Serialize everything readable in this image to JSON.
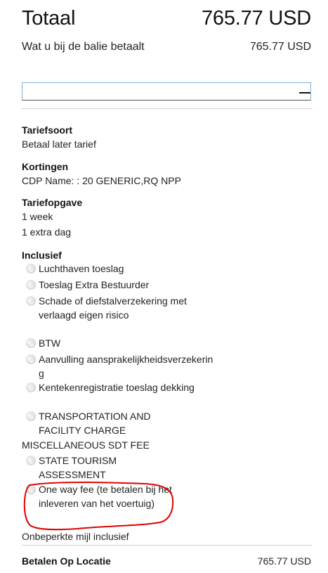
{
  "total": {
    "label": "Totaal",
    "amount": "765.77 USD"
  },
  "counter": {
    "label": "Wat u bij de balie betaalt",
    "amount": "765.77 USD"
  },
  "rate_type": {
    "heading": "Tariefsoort",
    "value": "Betaal later tarief"
  },
  "discounts": {
    "heading": "Kortingen",
    "value": "CDP Name: : 20 GENERIC,RQ NPP"
  },
  "rate_statement": {
    "heading": "Tariefopgave",
    "lines": [
      "1 week",
      "1 extra dag"
    ]
  },
  "included": {
    "heading": "Inclusief",
    "items": [
      {
        "text": "Luchthaven toeslag",
        "icon": "check-circle-icon"
      },
      {
        "text": "Toeslag Extra Bestuurder",
        "icon": "check-circle-icon"
      },
      {
        "text": "Schade of diefstalverzekering met verlaagd eigen risico",
        "icon": "check-circle-icon"
      },
      {
        "text": "BTW",
        "icon": "check-circle-icon"
      },
      {
        "text": "Aanvulling aansprakelijkheidsverzekering",
        "icon": "check-circle-icon"
      },
      {
        "text": "Kentekenregistratie toeslag dekking",
        "icon": "check-circle-icon"
      },
      {
        "text": "TRANSPORTATION AND FACILITY CHARGE",
        "icon": "check-circle-icon"
      },
      {
        "text": "MISCELLANEOUS SDT FEE",
        "icon": ""
      },
      {
        "text": "STATE TOURISM ASSESSMENT",
        "icon": "check-circle-icon"
      },
      {
        "text": "One way fee (te betalen bij het inleveren van het voertuig)",
        "icon": "check-circle-icon"
      }
    ]
  },
  "unlimited_mileage": "Onbeperkte mijl inclusief",
  "pay_at_location": {
    "label": "Betalen Op Locatie",
    "amount": "765.77 USD"
  },
  "colors": {
    "annotation": "#e00000",
    "collapse_border": "#7fb2d6"
  }
}
